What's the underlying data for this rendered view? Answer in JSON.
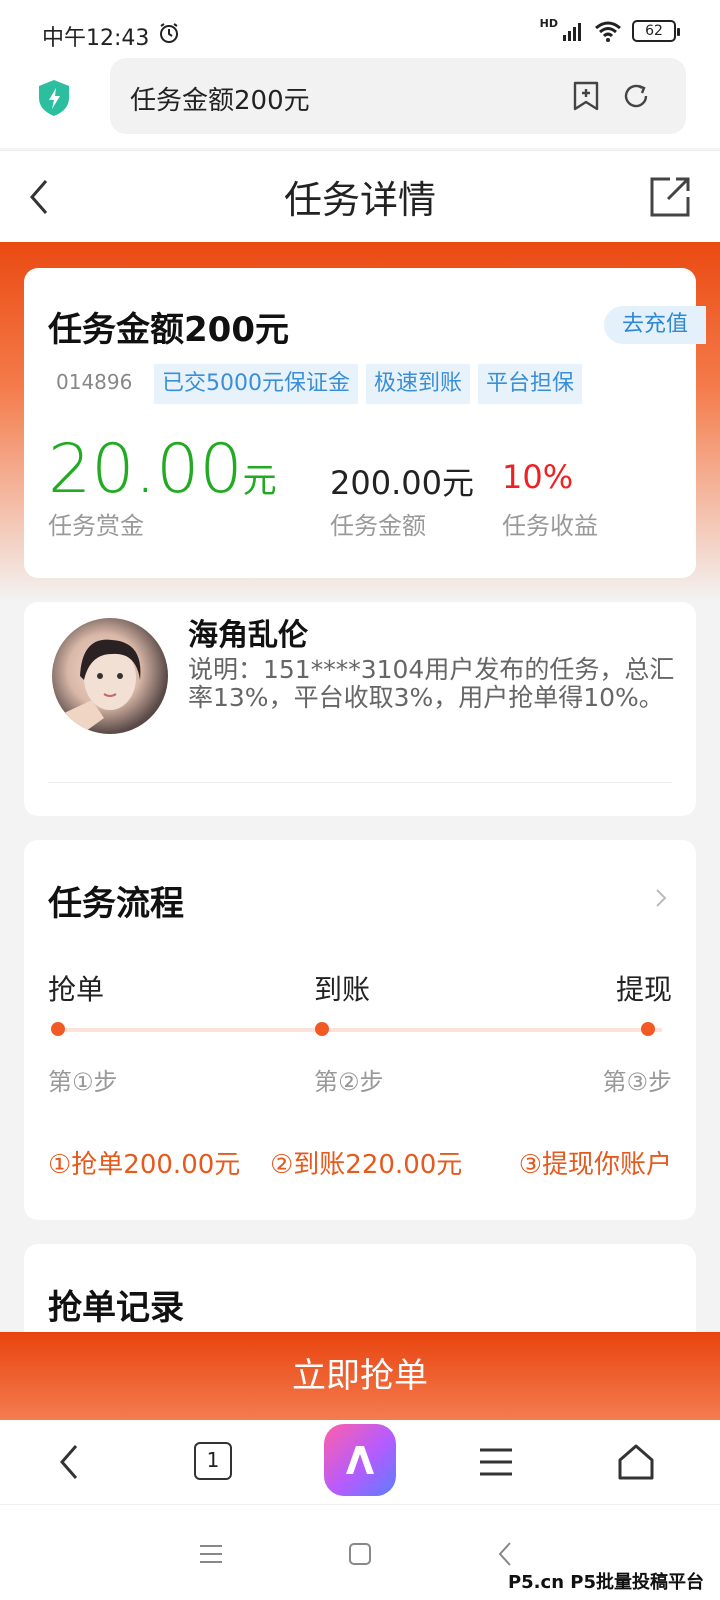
{
  "status_bar": {
    "time": "中午12:43",
    "network": "HD",
    "battery": "62"
  },
  "browser": {
    "url_text": "任务金额200元"
  },
  "header": {
    "title": "任务详情"
  },
  "task": {
    "title": "任务金额200元",
    "recharge_label": "去充值",
    "id": "014896",
    "tags": [
      "已交5000元保证金",
      "极速到账",
      "平台担保"
    ],
    "bounty_value": "20.00",
    "bounty_unit": "元",
    "bounty_label": "任务赏金",
    "amount_value": "200.00元",
    "amount_label": "任务金额",
    "return_value": "10%",
    "return_label": "任务收益"
  },
  "publisher": {
    "name": "海角乱伦",
    "description": "说明：151****3104用户发布的任务，总汇率13%，平台收取3%，用户抢单得10%。"
  },
  "process": {
    "title": "任务流程",
    "steps": [
      {
        "name": "抢单",
        "label": "第①步",
        "desc": "①抢单200.00元"
      },
      {
        "name": "到账",
        "label": "第②步",
        "desc": "②到账220.00元"
      },
      {
        "name": "提现",
        "label": "第③步",
        "desc": "③提现你账户"
      }
    ]
  },
  "records": {
    "title": "抢单记录"
  },
  "grab_button": "立即抢单",
  "toolbar": {
    "tab_count": "1"
  },
  "watermark": "P5.cn P5批量投稿平台",
  "colors": {
    "accent": "#f15a24",
    "bounty_green": "#22aa22",
    "return_red": "#ee2222",
    "tag_blue": "#3a8fd6"
  }
}
